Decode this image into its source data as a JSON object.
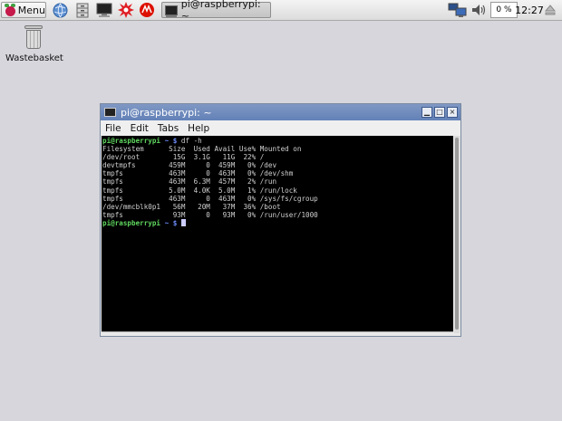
{
  "taskbar": {
    "menu_label": "Menu",
    "task_label": "pi@raspberrypi: ~",
    "cpu_usage": "0 %",
    "clock": "12:27"
  },
  "desktop": {
    "trash_label": "Wastebasket"
  },
  "window": {
    "title": "pi@raspberrypi: ~",
    "menus": [
      "File",
      "Edit",
      "Tabs",
      "Help"
    ],
    "minimize": "▁",
    "maximize": "□",
    "close": "×"
  },
  "terminal": {
    "prompt_user": "pi@raspberrypi",
    "prompt_path": "~ $",
    "command": "df -h",
    "output": [
      "Filesystem      Size  Used Avail Use% Mounted on",
      "/dev/root        15G  3.1G   11G  22% /",
      "devtmpfs        459M     0  459M   0% /dev",
      "tmpfs           463M     0  463M   0% /dev/shm",
      "tmpfs           463M  6.3M  457M   2% /run",
      "tmpfs           5.0M  4.0K  5.0M   1% /run/lock",
      "tmpfs           463M     0  463M   0% /sys/fs/cgroup",
      "/dev/mmcblk0p1   56M   20M   37M  36% /boot",
      "tmpfs            93M     0   93M   0% /run/user/1000"
    ]
  }
}
